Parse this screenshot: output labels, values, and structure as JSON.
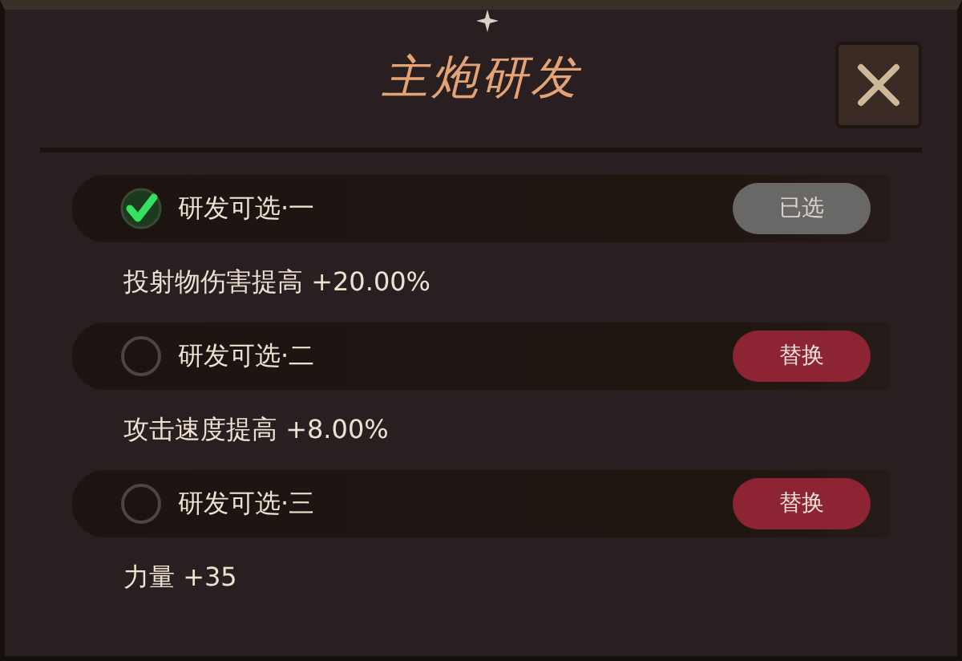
{
  "window": {
    "title": "主炮研发"
  },
  "options": [
    {
      "title": "研发可选·一",
      "selected": true,
      "button": "已选",
      "description": "投射物伤害提高 +20.00%"
    },
    {
      "title": "研发可选·二",
      "selected": false,
      "button": "替换",
      "description": "攻击速度提高 +8.00%"
    },
    {
      "title": "研发可选·三",
      "selected": false,
      "button": "替换",
      "description": "力量 +35"
    }
  ]
}
